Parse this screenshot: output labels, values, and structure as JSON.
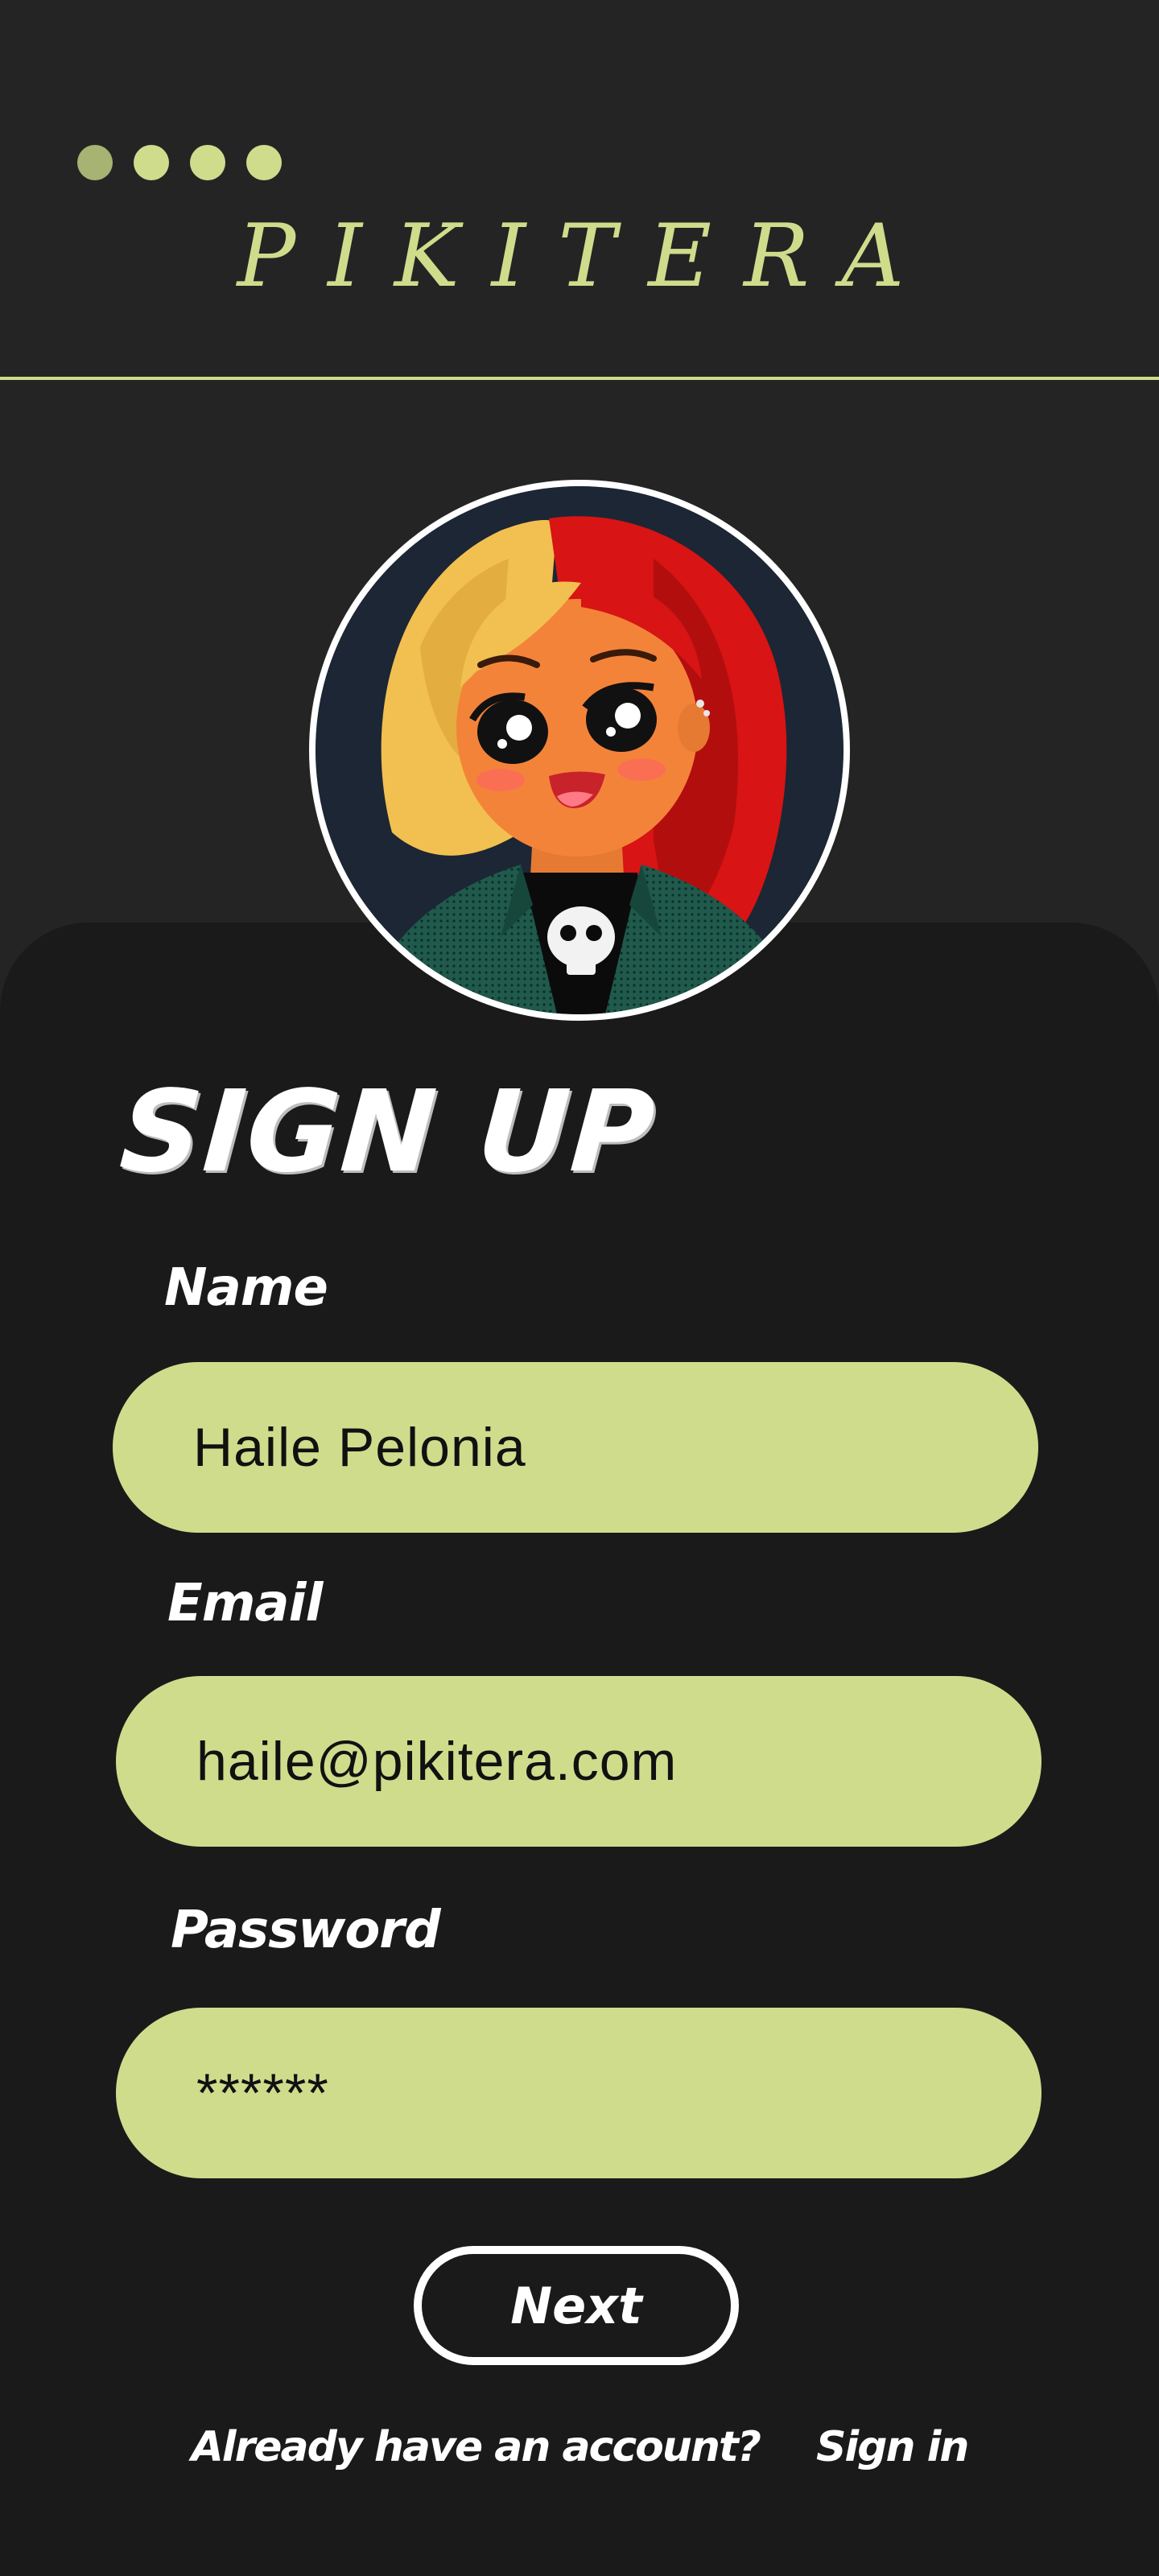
{
  "brand": {
    "name": "PIKITERA",
    "accent": "#cfdc8c",
    "dot_colors": [
      "#a6b372",
      "#cfdc8c",
      "#cfdc8c",
      "#cfdc8c"
    ]
  },
  "form": {
    "title": "SIGN UP",
    "name_label": "Name",
    "name_value": "Haile Pelonia",
    "email_label": "Email",
    "email_value": "haile@pikitera.com",
    "password_label": "Password",
    "password_value": "******",
    "field_color": "#cfdc8c",
    "next_label": "Next"
  },
  "footer": {
    "prompt": "Already have an account?",
    "signin": "Sign in"
  },
  "colors": {
    "background": "#242424",
    "card": "#1a1a1a",
    "text": "#ffffff"
  }
}
